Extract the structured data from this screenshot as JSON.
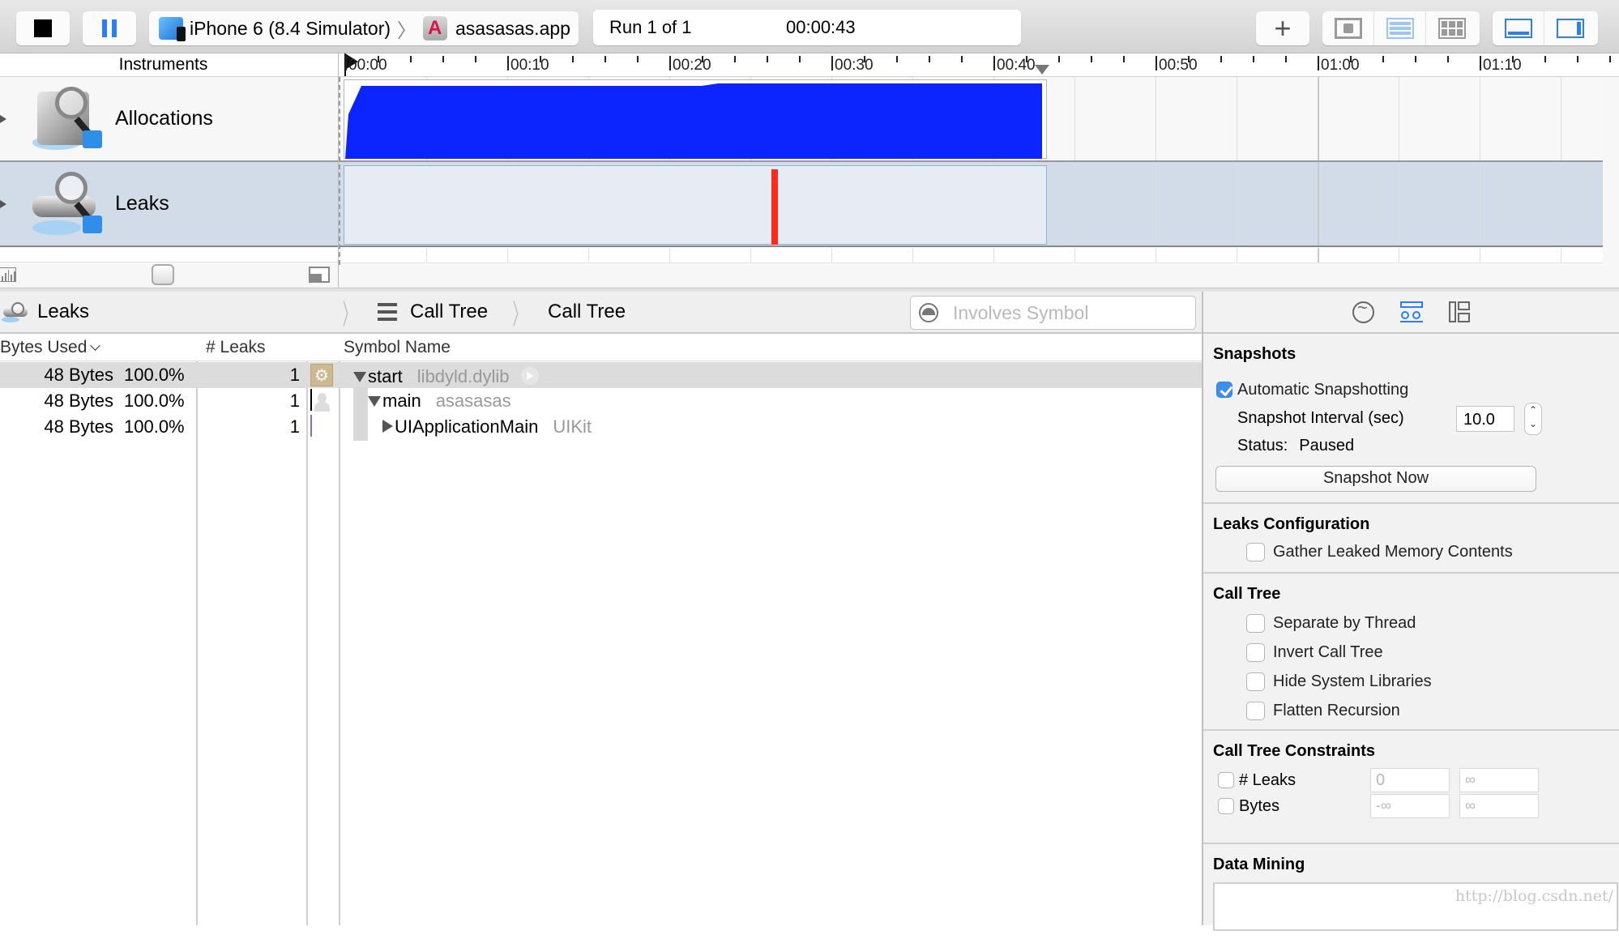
{
  "toolbar": {
    "stop_label": "Stop",
    "pause_label": "Pause",
    "device": "iPhone 6 (8.4 Simulator)",
    "target": "asasasas.app",
    "run_status": "Run 1 of 1",
    "elapsed": "00:00:43",
    "add_icon": "plus-icon",
    "view_icons": [
      "cpu-icon",
      "list-icon",
      "grid-icon"
    ],
    "panel_icons": [
      "bottom-panel-icon",
      "right-panel-icon"
    ]
  },
  "track_list": {
    "header": "Instruments",
    "instruments": [
      {
        "name": "Allocations",
        "icon": "allocations-instrument-icon",
        "selected": false
      },
      {
        "name": "Leaks",
        "icon": "leaks-instrument-icon",
        "selected": true
      }
    ]
  },
  "timeline": {
    "ticks": [
      "00:00",
      "00:10",
      "00:20",
      "00:30",
      "00:40",
      "00:50",
      "01:00",
      "01:10"
    ],
    "recording_end_sec": 43,
    "allocations_series": {
      "unit": "relative memory (0-1)",
      "points": [
        [
          0,
          0
        ],
        [
          0.2,
          0.55
        ],
        [
          1,
          0.9
        ],
        [
          10,
          0.9
        ],
        [
          22,
          0.9
        ],
        [
          23,
          0.93
        ],
        [
          43,
          0.93
        ]
      ]
    },
    "leak_events_sec": [
      26.5
    ],
    "colors": {
      "allocations": "#0c25ff",
      "leak": "#ff2a1a",
      "selected_lane": "#d2dce8"
    }
  },
  "detail": {
    "breadcrumb": [
      "Leaks",
      "Call Tree",
      "Call Tree"
    ],
    "search_placeholder": "Involves Symbol",
    "search_value": "",
    "columns": {
      "bytes_used": "Bytes Used",
      "leaks": "# Leaks",
      "symbol": "Symbol Name"
    },
    "rows": [
      {
        "bytes": "48 Bytes",
        "pct": "100.0%",
        "leaks": "1",
        "category": "gear",
        "symbol": "start",
        "library": "libdyld.dylib",
        "expanded": true,
        "depth": 0,
        "selected": true
      },
      {
        "bytes": "48 Bytes",
        "pct": "100.0%",
        "leaks": "1",
        "category": "user",
        "symbol": "main",
        "library": "asasasas",
        "expanded": true,
        "depth": 1,
        "selected": false
      },
      {
        "bytes": "48 Bytes",
        "pct": "100.0%",
        "leaks": "1",
        "category": "cup",
        "symbol": "UIApplicationMain",
        "library": "UIKit",
        "expanded": false,
        "depth": 2,
        "selected": false
      }
    ]
  },
  "inspector": {
    "tabs": [
      "record-settings-icon",
      "display-settings-icon",
      "extended-detail-icon"
    ],
    "snapshots": {
      "title": "Snapshots",
      "auto_label": "Automatic Snapshotting",
      "auto_checked": true,
      "interval_label": "Snapshot Interval (sec)",
      "interval_value": "10.0",
      "status_label": "Status:",
      "status_value": "Paused",
      "snapshot_now": "Snapshot Now"
    },
    "leaks_config": {
      "title": "Leaks Configuration",
      "gather_label": "Gather Leaked Memory Contents",
      "gather_checked": false
    },
    "call_tree": {
      "title": "Call Tree",
      "options": [
        {
          "label": "Separate by Thread",
          "checked": false
        },
        {
          "label": "Invert Call Tree",
          "checked": false
        },
        {
          "label": "Hide System Libraries",
          "checked": false
        },
        {
          "label": "Flatten Recursion",
          "checked": false
        }
      ]
    },
    "constraints": {
      "title": "Call Tree Constraints",
      "leaks_label": "# Leaks",
      "leaks_min": "0",
      "leaks_max": "∞",
      "bytes_label": "Bytes",
      "bytes_min": "-∞",
      "bytes_max": "∞"
    },
    "data_mining": {
      "title": "Data Mining",
      "watermark": "http://blog.csdn.net/"
    }
  }
}
